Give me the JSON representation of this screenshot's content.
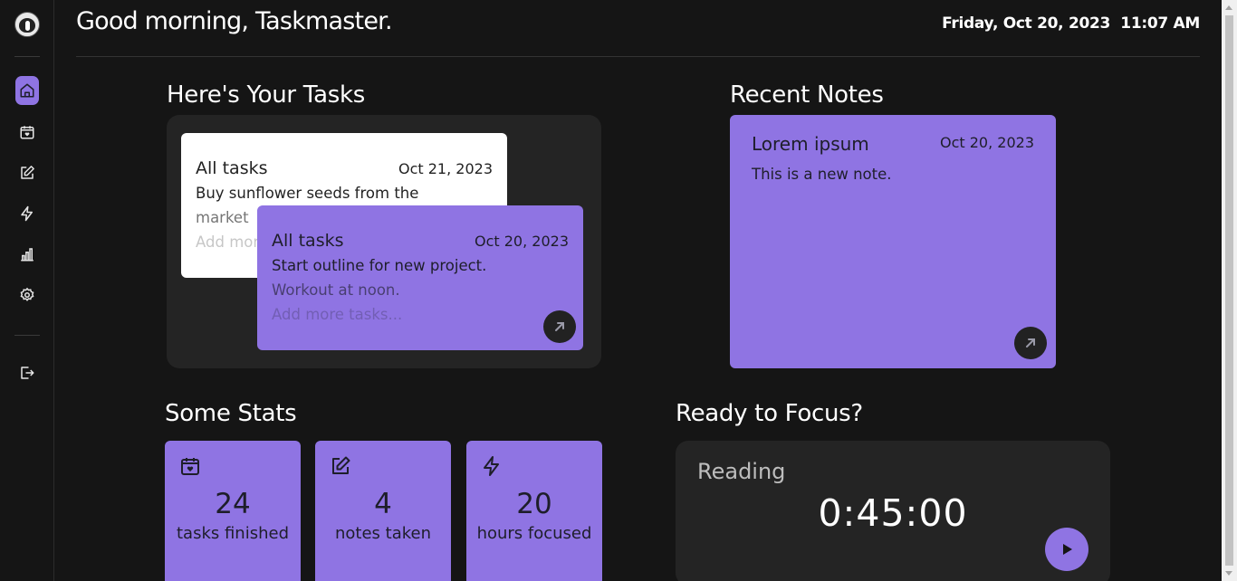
{
  "header": {
    "greeting": "Good morning, Taskmaster.",
    "datetime": "Friday, Oct 20, 2023  11:07 AM"
  },
  "sidebar": {
    "items": [
      {
        "name": "home",
        "icon": "home-icon",
        "active": true
      },
      {
        "name": "calendar",
        "icon": "calendar-heart-icon",
        "active": false
      },
      {
        "name": "notes",
        "icon": "edit-icon",
        "active": false
      },
      {
        "name": "focus",
        "icon": "lightning-icon",
        "active": false
      },
      {
        "name": "stats",
        "icon": "bar-chart-icon",
        "active": false
      },
      {
        "name": "settings",
        "icon": "gear-icon",
        "active": false
      }
    ],
    "logout_icon": "logout-icon"
  },
  "tasks": {
    "title": "Here's Your Tasks",
    "cards": [
      {
        "title": "All tasks",
        "date": "Oct 21, 2023",
        "lines": [
          "Buy sunflower seeds from the",
          "market",
          "Add more tasks..."
        ]
      },
      {
        "title": "All tasks",
        "date": "Oct 20, 2023",
        "lines": [
          "Start outline for new project.",
          "Workout at noon.",
          "Add more tasks..."
        ]
      }
    ]
  },
  "notes": {
    "title": "Recent Notes",
    "card": {
      "title": "Lorem ipsum",
      "date": "Oct 20, 2023",
      "body": "This is a new note."
    }
  },
  "stats": {
    "title": "Some Stats",
    "cards": [
      {
        "icon": "calendar-heart-icon",
        "value": "24",
        "label": "tasks finished"
      },
      {
        "icon": "edit-icon",
        "value": "4",
        "label": "notes taken"
      },
      {
        "icon": "lightning-icon",
        "value": "20",
        "label": "hours focused"
      }
    ]
  },
  "focus": {
    "title": "Ready to Focus?",
    "label": "Reading",
    "time": "0:45:00"
  },
  "colors": {
    "background": "#151515",
    "panel": "#242424",
    "accent": "#8f74e3"
  }
}
